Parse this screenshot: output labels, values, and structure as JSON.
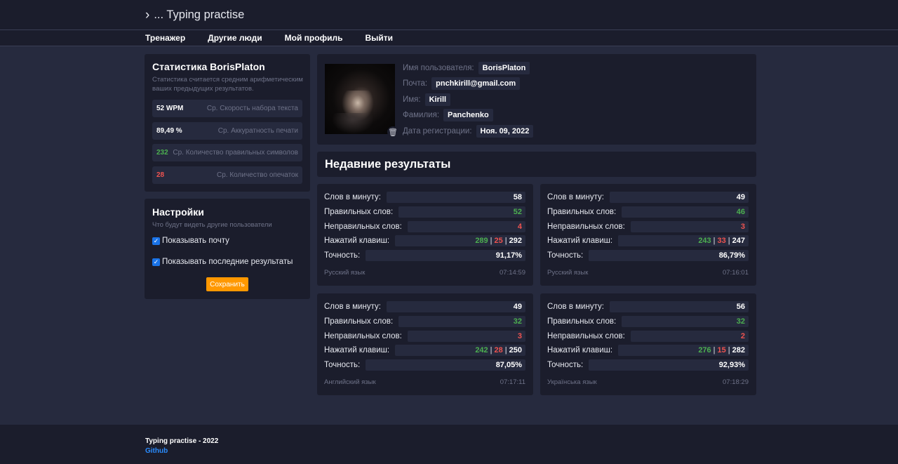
{
  "header": {
    "brand_icon": "chevron-right-icon",
    "brand": "... Typing practise"
  },
  "nav": {
    "items": [
      {
        "label": "Тренажер"
      },
      {
        "label": "Другие люди"
      },
      {
        "label": "Мой профиль"
      },
      {
        "label": "Выйти"
      }
    ]
  },
  "stats": {
    "title": "Статистика BorisPlaton",
    "subtitle": "Статистика считается средним арифметическим ваших предыдущих результатов.",
    "rows": [
      {
        "value": "52 WPM",
        "label": "Ср. Скорость набора текста"
      },
      {
        "value": "89,49 %",
        "label": "Ср. Аккуратность печати"
      },
      {
        "value": "232",
        "label": "Ср. Количество правильных символов"
      },
      {
        "value": "28",
        "label": "Ср. Количество опечаток"
      }
    ]
  },
  "settings": {
    "title": "Настройки",
    "subtitle": "Что будут видеть другие пользователи",
    "options": [
      {
        "label": "Показывать почту",
        "checked": true
      },
      {
        "label": "Показывать последние результаты",
        "checked": true
      }
    ],
    "save_label": "Сохранить"
  },
  "profile": {
    "fields": [
      {
        "label": "Имя пользователя:",
        "value": "BorisPlaton"
      },
      {
        "label": "Почта:",
        "value": "pnchkirill@gmail.com"
      },
      {
        "label": "Имя:",
        "value": "Kirill"
      },
      {
        "label": "Фамилия:",
        "value": "Panchenko"
      },
      {
        "label": "Дата регистрации:",
        "value": "Ноя. 09, 2022"
      }
    ],
    "avatar_icon": "avatar",
    "delete_icon": "trash-icon"
  },
  "recent": {
    "title": "Недавние результаты",
    "labels": {
      "wpm": "Слов в минуту:",
      "correct": "Правильных слов:",
      "wrong": "Неправильных слов:",
      "keys": "Нажатий клавиш:",
      "accuracy": "Точность:"
    },
    "results": [
      {
        "wpm": "58",
        "correct": "52",
        "wrong": "4",
        "keys_correct": "289",
        "keys_wrong": "25",
        "keys_total": "292",
        "accuracy": "91,17%",
        "language": "Русский язык",
        "time": "07:14:59"
      },
      {
        "wpm": "49",
        "correct": "46",
        "wrong": "3",
        "keys_correct": "243",
        "keys_wrong": "33",
        "keys_total": "247",
        "accuracy": "86,79%",
        "language": "Русский язык",
        "time": "07:16:01"
      },
      {
        "wpm": "49",
        "correct": "32",
        "wrong": "3",
        "keys_correct": "242",
        "keys_wrong": "28",
        "keys_total": "250",
        "accuracy": "87,05%",
        "language": "Английский язык",
        "time": "07:17:11"
      },
      {
        "wpm": "56",
        "correct": "32",
        "wrong": "2",
        "keys_correct": "276",
        "keys_wrong": "15",
        "keys_total": "282",
        "accuracy": "92,93%",
        "language": "Українська язык",
        "time": "07:18:29"
      }
    ],
    "separator": "|"
  },
  "footer": {
    "copyright": "Typing practise - 2022",
    "github": "Github"
  },
  "colors": {
    "background": "#262a3e",
    "panel": "#1b1d2c",
    "accent": "#ff9800",
    "success": "#4caf50",
    "error": "#ef5350",
    "link": "#2a8cff",
    "checkbox": "#1a73e8"
  }
}
